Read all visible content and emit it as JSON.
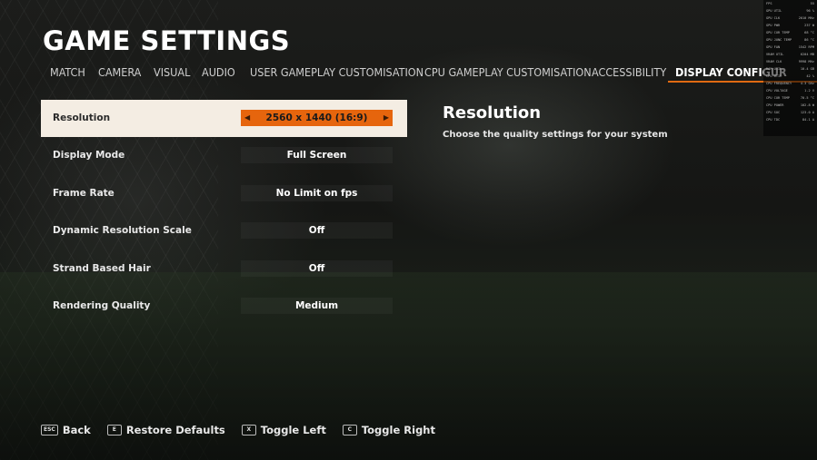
{
  "title": "GAME SETTINGS",
  "tabs": [
    {
      "label": "MATCH"
    },
    {
      "label": "CAMERA"
    },
    {
      "label": "VISUAL"
    },
    {
      "label": "AUDIO"
    },
    {
      "label": "USER GAMEPLAY CUSTOMISATION"
    },
    {
      "label": "CPU GAMEPLAY CUSTOMISATION"
    },
    {
      "label": "ACCESSIBILITY"
    },
    {
      "label": "DISPLAY CONFIGUR"
    }
  ],
  "active_tab": "DISPLAY CONFIGUR",
  "settings": [
    {
      "label": "Resolution",
      "value": "2560 x 1440 (16:9)"
    },
    {
      "label": "Display Mode",
      "value": "Full Screen"
    },
    {
      "label": "Frame Rate",
      "value": "No Limit on fps"
    },
    {
      "label": "Dynamic Resolution Scale",
      "value": "Off"
    },
    {
      "label": "Strand Based Hair",
      "value": "Off"
    },
    {
      "label": "Rendering Quality",
      "value": "Medium"
    }
  ],
  "info": {
    "heading": "Resolution",
    "description": "Choose the quality settings for your system"
  },
  "footer": [
    {
      "key": "ESC",
      "label": "Back"
    },
    {
      "key": "E",
      "label": "Restore Defaults"
    },
    {
      "key": "X",
      "label": "Toggle Left"
    },
    {
      "key": "C",
      "label": "Toggle Right"
    }
  ],
  "hud": [
    {
      "k": "FPS",
      "v": "55"
    },
    {
      "k": "GPU UTIL",
      "v": "96 %"
    },
    {
      "k": "GPU CLK",
      "v": "2010 MHz"
    },
    {
      "k": "GPU PWR",
      "v": "237 W"
    },
    {
      "k": "GPU CUR TEMP",
      "v": "68 °C"
    },
    {
      "k": "GPU JUNC TEMP",
      "v": "86 °C"
    },
    {
      "k": "GPU FAN",
      "v": "1542 RPM"
    },
    {
      "k": "VRAM UTIL",
      "v": "6204 MB"
    },
    {
      "k": "VRAM CLK",
      "v": "9998 MHz"
    },
    {
      "k": "RAM UTIL",
      "v": "10.4 GB"
    },
    {
      "k": "CPU UTIL",
      "v": "42 %"
    },
    {
      "k": "CPU FREQUENCY",
      "v": "4.3 GHz"
    },
    {
      "k": "CPU VOLTAGE",
      "v": "1.2 V"
    },
    {
      "k": "CPU CUR TEMP",
      "v": "70.5 °C"
    },
    {
      "k": "CPU POWER",
      "v": "102.8 W"
    },
    {
      "k": "CPU SOC",
      "v": "123.0 A"
    },
    {
      "k": "CPU TDC",
      "v": "84.1 A"
    }
  ]
}
